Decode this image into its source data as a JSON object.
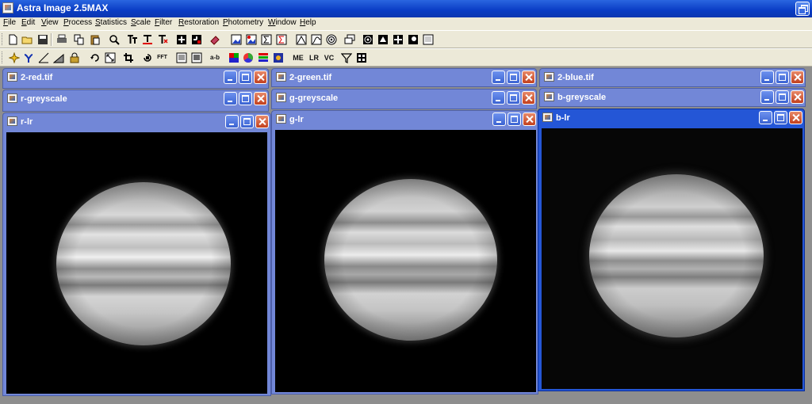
{
  "app": {
    "title": "Astra Image 2.5MAX"
  },
  "menu": [
    {
      "label": "File",
      "mnemonic": "F",
      "rest": "ile"
    },
    {
      "label": "Edit",
      "mnemonic": "E",
      "rest": "dit"
    },
    {
      "label": "View",
      "mnemonic": "V",
      "rest": "iew"
    },
    {
      "label": "Process",
      "mnemonic": "P",
      "rest": "rocess"
    },
    {
      "label": "Statistics",
      "mnemonic": "S",
      "rest": "tatistics"
    },
    {
      "label": "Scale",
      "mnemonic": "S",
      "rest": "cale"
    },
    {
      "label": "Filter",
      "mnemonic": "F",
      "rest": "ilter"
    },
    {
      "label": "Restoration",
      "mnemonic": "R",
      "rest": "estoration"
    },
    {
      "label": "Photometry",
      "mnemonic": "P",
      "rest": "hotometry"
    },
    {
      "label": "Window",
      "mnemonic": "W",
      "rest": "indow"
    },
    {
      "label": "Help",
      "mnemonic": "H",
      "rest": "elp"
    }
  ],
  "toolbar": {
    "me_label": "ME",
    "lr_label": "LR",
    "vc_label": "VC",
    "ab_label": "a-b",
    "fft_label": "FFT"
  },
  "windows": {
    "red_tif": {
      "title": "2-red.tif"
    },
    "r_grey": {
      "title": "r-greyscale"
    },
    "r_lr": {
      "title": "r-lr"
    },
    "green_tif": {
      "title": "2-green.tif"
    },
    "g_grey": {
      "title": "g-greyscale"
    },
    "g_lr": {
      "title": "g-lr"
    },
    "blue_tif": {
      "title": "2-blue.tif"
    },
    "b_grey": {
      "title": "b-greyscale"
    },
    "b_lr": {
      "title": "b-lr"
    }
  }
}
